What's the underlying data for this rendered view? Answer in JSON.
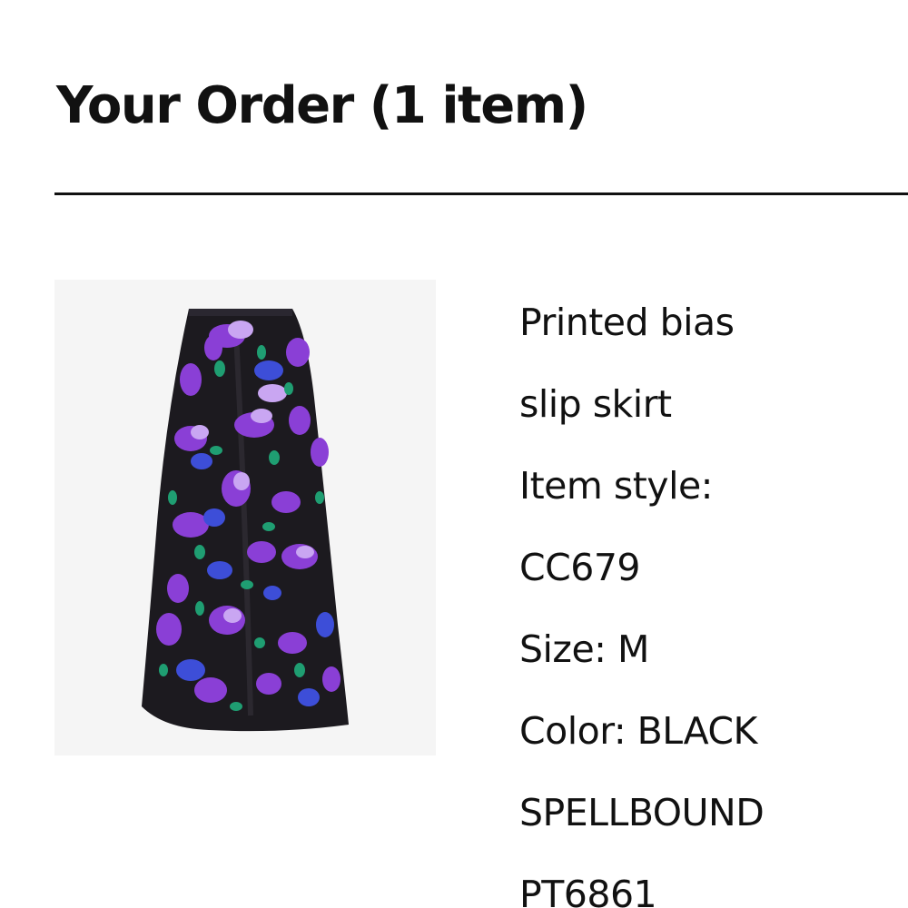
{
  "order": {
    "title": "Your Order (1 item)"
  },
  "item": {
    "image_icon": "product-photo",
    "name_line_1": "Printed bias",
    "name_line_2": "slip skirt",
    "style_label": "Item style:",
    "style_code": "CC679",
    "size": "Size: M",
    "color_line_1": "Color: BLACK",
    "color_line_2": "SPELLBOUND",
    "color_code": "PT6861"
  },
  "colors": {
    "text": "#111111",
    "image_background": "#f5f5f5",
    "skirt": "#1c1a1f",
    "flower_purple": "#8a3fd6",
    "flower_lilac": "#c9a6f2",
    "flower_blue": "#3d4ed8",
    "leaf_green": "#1f9e72"
  }
}
